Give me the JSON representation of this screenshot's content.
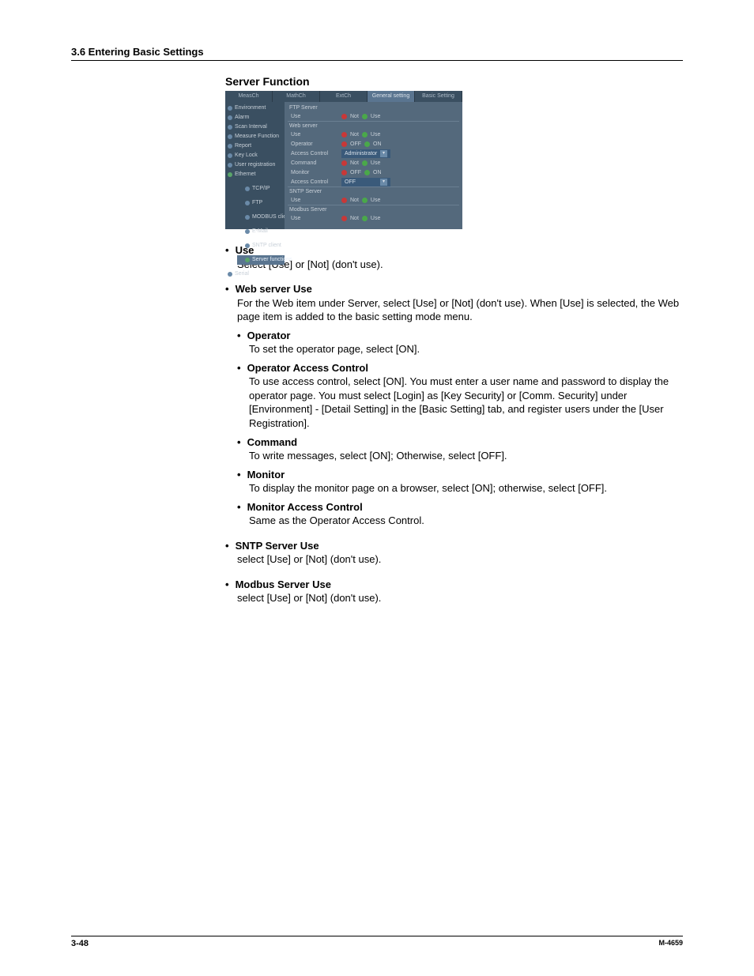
{
  "header": "3.6  Entering Basic Settings",
  "section_title": "Server Function",
  "screenshot": {
    "tabs": [
      "MeasCh",
      "MathCh",
      "ExtCh",
      "General setting",
      "Basic Setting"
    ],
    "sidebar": [
      {
        "label": "Environment",
        "icon": "n"
      },
      {
        "label": "Alarm",
        "icon": "n"
      },
      {
        "label": "Scan Interval",
        "icon": "n"
      },
      {
        "label": "Measure Function",
        "icon": "n"
      },
      {
        "label": "Report",
        "icon": "n"
      },
      {
        "label": "Key Lock",
        "icon": "n"
      },
      {
        "label": "User registration",
        "icon": "n"
      },
      {
        "label": "Ethernet",
        "icon": "g"
      },
      {
        "label": "TCP/IP",
        "icon": "n",
        "sub": true
      },
      {
        "label": "FTP",
        "icon": "n",
        "sub": true
      },
      {
        "label": "MODBUS client",
        "icon": "n",
        "sub": true
      },
      {
        "label": "E-Mail",
        "icon": "n",
        "sub": true
      },
      {
        "label": "SNTP client",
        "icon": "n",
        "sub": true
      },
      {
        "label": "Server functions",
        "icon": "g",
        "sub": true,
        "sel": true
      },
      {
        "label": "Serial",
        "icon": "n"
      }
    ],
    "panel": {
      "ftp": {
        "title": "FTP Server",
        "use": "Use",
        "not": "Not",
        "uselbl": "Use"
      },
      "web": {
        "title": "Web server",
        "rows": [
          {
            "lbl": "Use",
            "a": "Not",
            "b": "Use",
            "asel": false,
            "bsel": true
          },
          {
            "lbl": "Operator",
            "a": "OFF",
            "b": "ON",
            "asel": false,
            "bsel": true
          },
          {
            "lbl": "Access Control",
            "select": "Administrator"
          },
          {
            "lbl": "Command",
            "a": "Not",
            "b": "Use",
            "asel": false,
            "bsel": true
          },
          {
            "lbl": "Monitor",
            "a": "OFF",
            "b": "ON",
            "asel": false,
            "bsel": true
          },
          {
            "lbl": "Access Control",
            "select": "OFF"
          }
        ]
      },
      "sntp": {
        "title": "SNTP Server",
        "use": "Use",
        "not": "Not",
        "uselbl": "Use"
      },
      "modbus": {
        "title": "Modbus Server",
        "use": "Use",
        "not": "Not",
        "uselbl": "Use"
      }
    }
  },
  "items": [
    {
      "h": "Use",
      "body": "Select [Use] or [Not] (don't use)."
    },
    {
      "h": "Web server Use",
      "body": "For the Web item under Server, select [Use] or [Not] (don't use).  When [Use] is selected, the Web page item is added to the basic setting mode menu.",
      "subs": [
        {
          "h": "Operator",
          "body": "To set the operator page, select [ON]."
        },
        {
          "h": "Operator Access Control",
          "body": "To use access control, select [ON].  You must enter a user name and password to display the operator page.  You must select [Login] as [Key Security] or [Comm. Security] under [Environment] - [Detail Setting] in the [Basic Setting] tab, and register users under the [User Registration]."
        },
        {
          "h": "Command",
          "body": "To write messages, select [ON]; Otherwise, select [OFF]."
        },
        {
          "h": "Monitor",
          "body": "To display the monitor page on a browser, select [ON]; otherwise, select [OFF]."
        },
        {
          "h": "Monitor Access Control",
          "body": "Same as the Operator Access Control."
        }
      ]
    },
    {
      "h": "SNTP Server Use",
      "body": "select [Use] or [Not] (don't use)."
    },
    {
      "h": "Modbus Server Use",
      "body": "select [Use] or [Not] (don't use)."
    }
  ],
  "footer": {
    "left": "3-48",
    "right": "M-4659"
  }
}
